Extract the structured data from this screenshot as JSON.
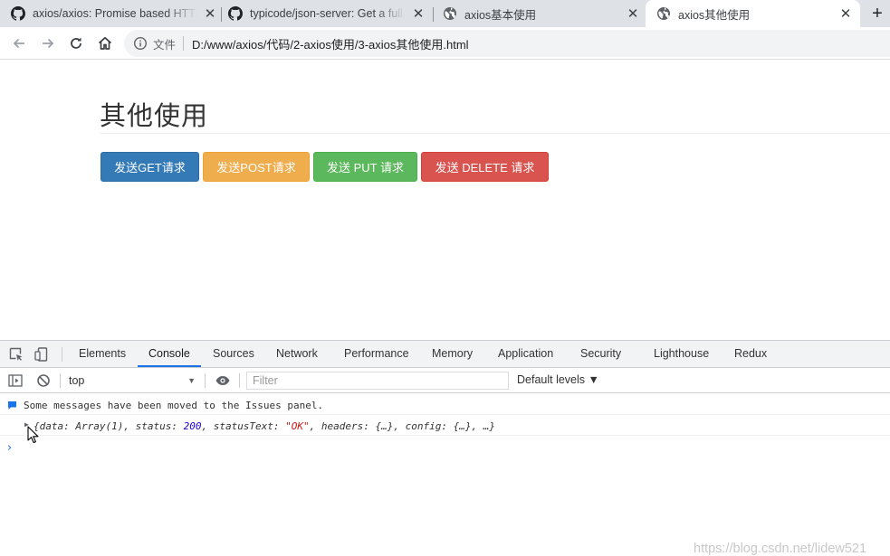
{
  "browser": {
    "tabs": [
      {
        "title": "axios/axios: Promise based HTTP client for the browser and node.js",
        "icon": "github-icon",
        "active": false
      },
      {
        "title": "typicode/json-server: Get a full fake REST API with zero coding",
        "icon": "github-icon",
        "active": false
      },
      {
        "title": "axios基本使用",
        "icon": "globe-icon",
        "active": false
      },
      {
        "title": "axios其他使用",
        "icon": "globe-icon",
        "active": true
      }
    ],
    "new_tab": "+",
    "close_glyph": "✕",
    "address": {
      "scheme_label": "文件",
      "url": "D:/www/axios/代码/2-axios使用/3-axios其他使用.html"
    }
  },
  "page": {
    "title": "其他使用",
    "buttons": [
      {
        "label": "发送GET请求",
        "color": "#337ab7"
      },
      {
        "label": "发送POST请求",
        "color": "#f0ad4e"
      },
      {
        "label": "发送 PUT 请求",
        "color": "#5cb85c"
      },
      {
        "label": "发送 DELETE 请求",
        "color": "#d9534f"
      }
    ]
  },
  "devtools": {
    "tabs": [
      "Elements",
      "Console",
      "Sources",
      "Network",
      "Performance",
      "Memory",
      "Application",
      "Security",
      "Lighthouse",
      "Redux"
    ],
    "active_tab": "Console",
    "context": "top",
    "filter_placeholder": "Filter",
    "levels": "Default levels ▼",
    "messages": [
      {
        "text": "Some messages have been moved to the Issues panel."
      }
    ],
    "log": {
      "p1": "{data: Array(1), status: ",
      "status": "200",
      "p2": ", statusText: ",
      "status_text": "\"OK\"",
      "p3": ", headers: {…}, config: {…}, …}"
    },
    "prompt": "›"
  },
  "watermark": "https://blog.csdn.net/lidew521",
  "colors": {
    "accent": "#1a73e8",
    "tabstrip": "#dee1e6"
  }
}
